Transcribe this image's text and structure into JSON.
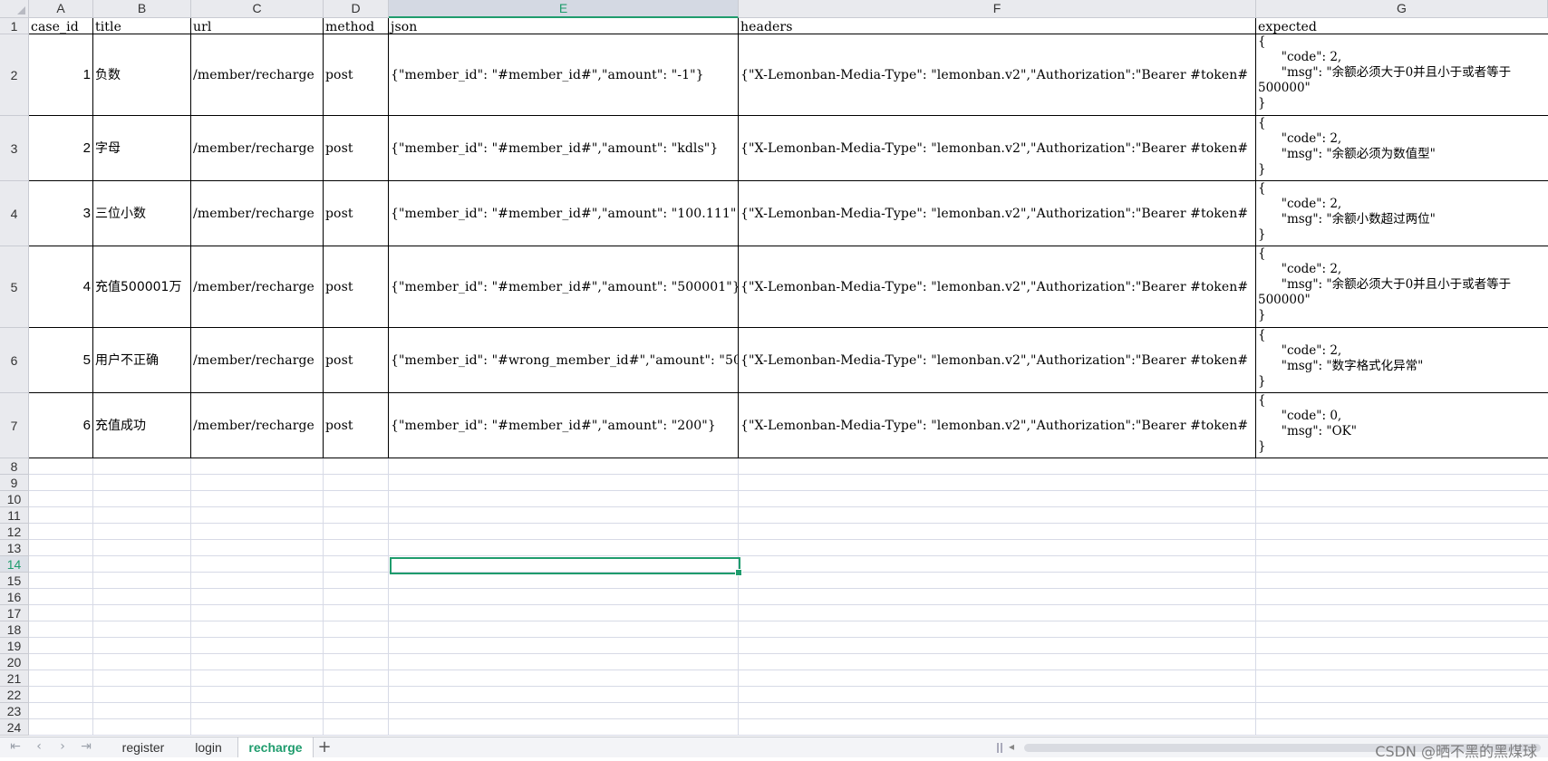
{
  "app": {
    "accent": "#1f9c6d",
    "grid_color": "#d7dae6",
    "header_bg": "#e9eaee"
  },
  "columns": [
    "A",
    "B",
    "C",
    "D",
    "E",
    "F",
    "G"
  ],
  "active_column": "E",
  "row_numbers": [
    "1",
    "2",
    "3",
    "4",
    "5",
    "6",
    "7",
    "8",
    "9",
    "10",
    "11",
    "12",
    "13",
    "14",
    "15",
    "16",
    "17",
    "18",
    "19",
    "20",
    "21",
    "22",
    "23",
    "24"
  ],
  "active_row": "14",
  "selected_cell": "E14",
  "header_row": {
    "case_id": "case_id",
    "title": "title",
    "url": "url",
    "method": "method",
    "json": "json",
    "headers": "headers",
    "expected": "expected"
  },
  "rows": [
    {
      "case_id": "1",
      "title": "负数",
      "url": "/member/recharge",
      "method": "post",
      "json": "{\"member_id\": \"#member_id#\",\"amount\": \"-1\"}",
      "headers": "{\"X-Lemonban-Media-Type\": \"lemonban.v2\",\"Authorization\":\"Bearer #token#",
      "expected": "{\n      \"code\": 2,\n      \"msg\": \"余额必须大于0并且小于或者等于\n500000\"\n}"
    },
    {
      "case_id": "2",
      "title": "字母",
      "url": "/member/recharge",
      "method": "post",
      "json": "{\"member_id\": \"#member_id#\",\"amount\": \"kdls\"}",
      "headers": "{\"X-Lemonban-Media-Type\": \"lemonban.v2\",\"Authorization\":\"Bearer #token#",
      "expected": "{\n      \"code\": 2,\n      \"msg\": \"余额必须为数值型\"\n}"
    },
    {
      "case_id": "3",
      "title": "三位小数",
      "url": "/member/recharge",
      "method": "post",
      "json": "{\"member_id\": \"#member_id#\",\"amount\": \"100.111\"}",
      "headers": "{\"X-Lemonban-Media-Type\": \"lemonban.v2\",\"Authorization\":\"Bearer #token#",
      "expected": "{\n      \"code\": 2,\n      \"msg\": \"余额小数超过两位\"\n}"
    },
    {
      "case_id": "4",
      "title": "充值500001万",
      "url": "/member/recharge",
      "method": "post",
      "json": "{\"member_id\": \"#member_id#\",\"amount\": \"500001\"}",
      "headers": "{\"X-Lemonban-Media-Type\": \"lemonban.v2\",\"Authorization\":\"Bearer #token#",
      "expected": "{\n      \"code\": 2,\n      \"msg\": \"余额必须大于0并且小于或者等于\n500000\"\n}"
    },
    {
      "case_id": "5",
      "title": "用户不正确",
      "url": "/member/recharge",
      "method": "post",
      "json": "{\"member_id\": \"#wrong_member_id#\",\"amount\": \"500",
      "headers": "{\"X-Lemonban-Media-Type\": \"lemonban.v2\",\"Authorization\":\"Bearer #token#",
      "expected": "{\n      \"code\": 2,\n      \"msg\": \"数字格式化异常\"\n}"
    },
    {
      "case_id": "6",
      "title": "充值成功",
      "url": "/member/recharge",
      "method": "post",
      "json": "{\"member_id\": \"#member_id#\",\"amount\": \"200\"}",
      "headers": "{\"X-Lemonban-Media-Type\": \"lemonban.v2\",\"Authorization\":\"Bearer #token#",
      "expected": "{\n      \"code\": 0,\n      \"msg\": \"OK\"\n}"
    }
  ],
  "tabs": {
    "items": [
      "register",
      "login",
      "recharge"
    ],
    "active": "recharge",
    "add_symbol": "+"
  },
  "nav_icons": [
    "first-sheet-icon",
    "prev-sheet-icon",
    "next-sheet-icon",
    "last-sheet-icon"
  ],
  "watermark": "CSDN @晒不黑的黑煤球"
}
